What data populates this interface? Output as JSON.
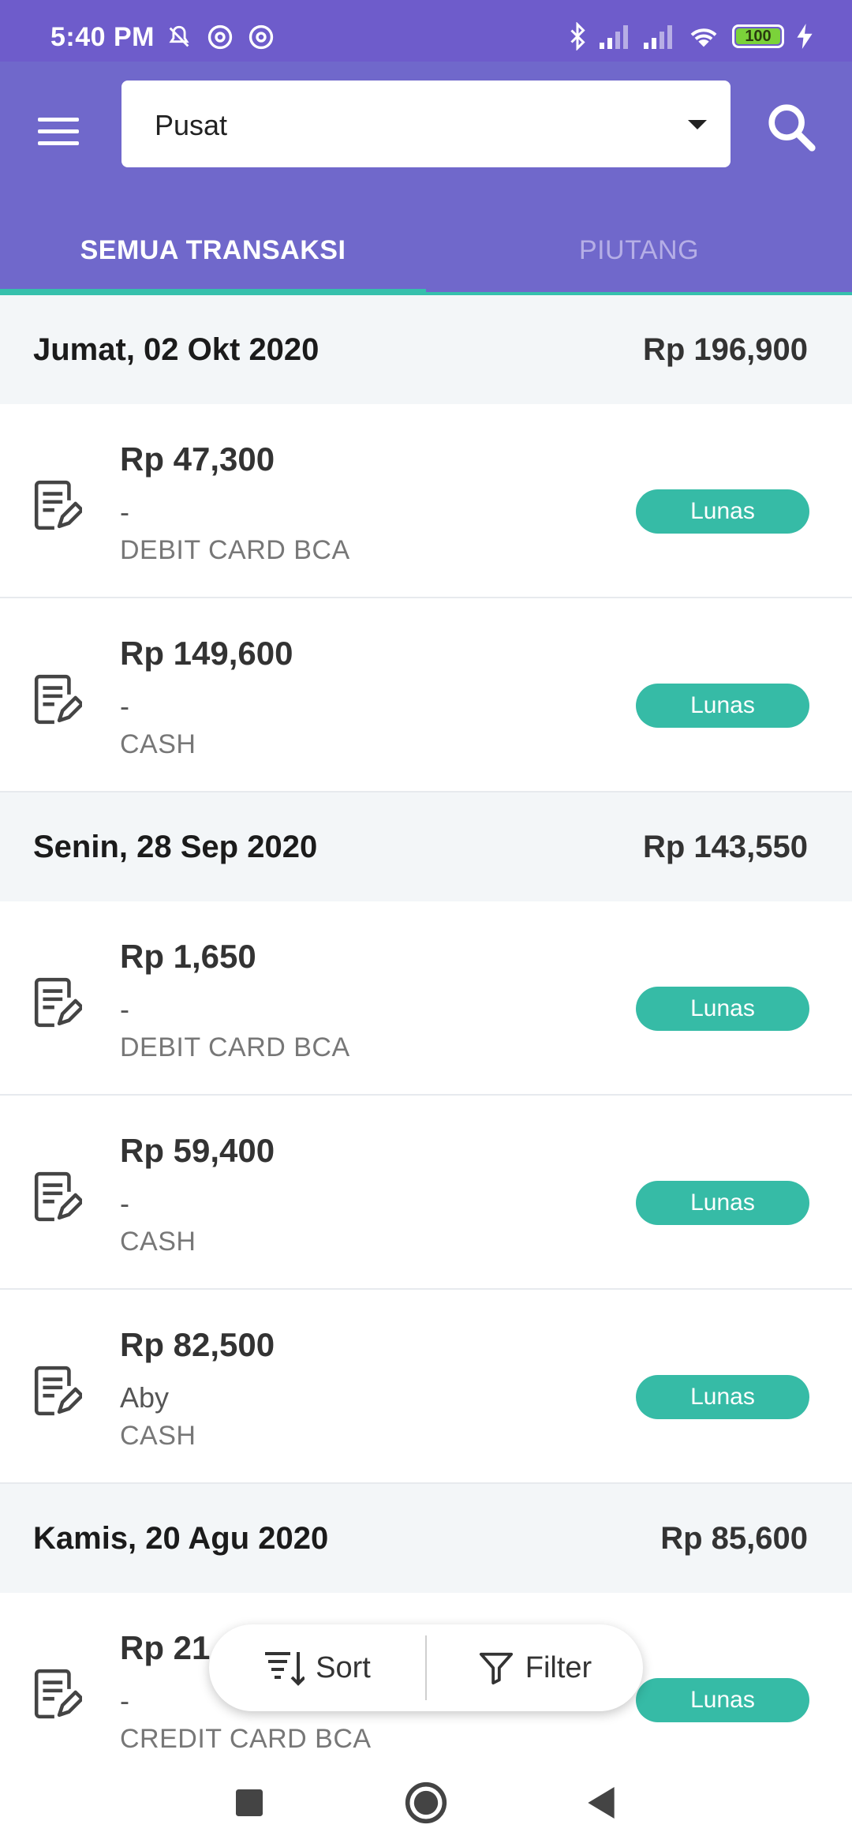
{
  "status_bar": {
    "time": "5:40 PM",
    "battery": "100",
    "icons": [
      "silent-bell-icon",
      "at-icon",
      "at-icon",
      "bluetooth-icon",
      "signal-icon",
      "signal-icon",
      "wifi-icon",
      "charging-icon"
    ]
  },
  "header": {
    "branch_selector": {
      "value": "Pusat"
    },
    "icons": [
      "menu-icon",
      "search-icon"
    ]
  },
  "tabs": [
    {
      "label": "SEMUA TRANSAKSI",
      "active": true
    },
    {
      "label": "PIUTANG",
      "active": false
    }
  ],
  "groups": [
    {
      "date": "Jumat, 02 Okt 2020",
      "total": "Rp 196,900",
      "transactions": [
        {
          "amount": "Rp 47,300",
          "customer": "-",
          "method": "DEBIT CARD BCA",
          "status": "Lunas"
        },
        {
          "amount": "Rp 149,600",
          "customer": "-",
          "method": "CASH",
          "status": "Lunas"
        }
      ]
    },
    {
      "date": "Senin, 28 Sep 2020",
      "total": "Rp 143,550",
      "transactions": [
        {
          "amount": "Rp 1,650",
          "customer": "-",
          "method": "DEBIT CARD BCA",
          "status": "Lunas"
        },
        {
          "amount": "Rp 59,400",
          "customer": "-",
          "method": "CASH",
          "status": "Lunas"
        },
        {
          "amount": "Rp 82,500",
          "customer": "Aby",
          "method": "CASH",
          "status": "Lunas"
        }
      ]
    },
    {
      "date": "Kamis, 20 Agu 2020",
      "total": "Rp 85,600",
      "transactions": [
        {
          "amount": "Rp 21,4",
          "customer": "-",
          "method": "CREDIT CARD BCA",
          "status": "Lunas"
        }
      ]
    }
  ],
  "bottom_actions": {
    "sort_label": "Sort",
    "filter_label": "Filter"
  },
  "colors": {
    "primary": "#7068cb",
    "status_bar": "#6e5ccb",
    "accent": "#36c0ac",
    "badge": "#36bba6",
    "section_bg": "#f3f6f8"
  }
}
